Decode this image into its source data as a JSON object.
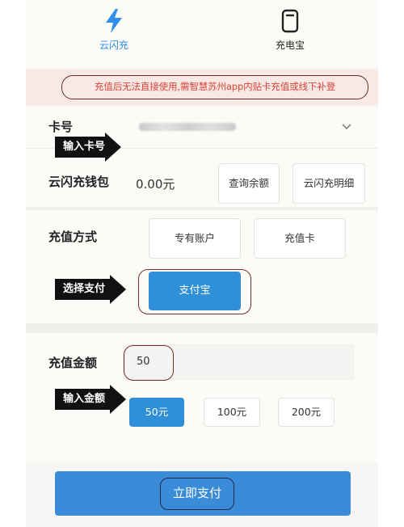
{
  "tabs": [
    {
      "label": "云闪充",
      "icon": "lightning-icon",
      "active": true
    },
    {
      "label": "充电宝",
      "icon": "power-bank-icon",
      "active": false
    }
  ],
  "notice": "充值后无法直接使用,需智慧苏州app内贴卡充值或线下补登",
  "card": {
    "label": "卡号",
    "callout": "输入卡号"
  },
  "wallet": {
    "label": "云闪充钱包",
    "balance": "0.00元",
    "query_button": "查询余额",
    "detail_button": "云闪充明细"
  },
  "method": {
    "label": "充值方式",
    "options": [
      "专有账户",
      "充值卡"
    ],
    "selected": "支付宝",
    "callout": "选择支付"
  },
  "amount": {
    "label": "充值金额",
    "value": "50",
    "callout": "输入金额",
    "presets": [
      "50元",
      "100元",
      "200元"
    ],
    "selected_preset": "50元"
  },
  "pay_button": "立即支付",
  "colors": {
    "accent": "#2f8fd7",
    "notice_text": "#d64538",
    "notice_bg": "#f9e9e6"
  }
}
